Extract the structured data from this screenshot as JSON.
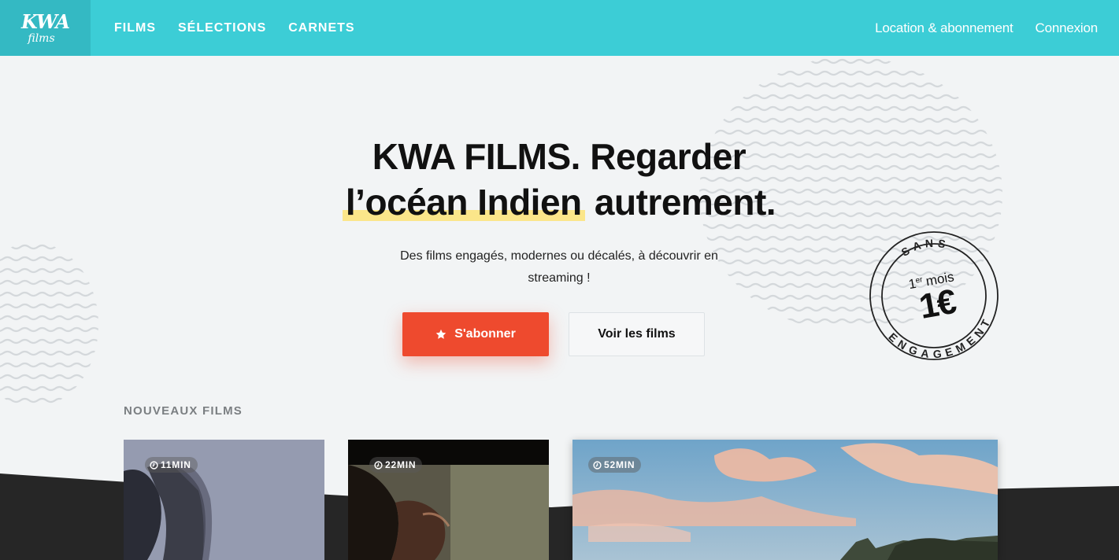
{
  "header": {
    "logo_line1": "KWA",
    "logo_line2": "films",
    "nav": [
      "FILMS",
      "SÉLECTIONS",
      "CARNETS"
    ],
    "right_links": [
      "Location & abonnement",
      "Connexion"
    ]
  },
  "hero": {
    "title_line1": "KWA FILMS. Regarder",
    "title_highlight": "l’océan Indien",
    "title_rest": " autrement.",
    "subtitle": "Des films engagés, modernes ou décalés, à découvrir en streaming !",
    "subscribe_label": "S'abonner",
    "films_label": "Voir les films"
  },
  "badge": {
    "top": "SANS",
    "bottom": "ENGAGEMENT",
    "ordinal": "1",
    "ordinal_sup": "er",
    "month": "mois",
    "price": "1€"
  },
  "section": {
    "title": "NOUVEAUX FILMS"
  },
  "films": [
    {
      "duration": "11MIN"
    },
    {
      "duration": "22MIN"
    },
    {
      "duration": "52MIN"
    }
  ],
  "colors": {
    "header": "#3ccdd6",
    "logo_bg": "#34b9c3",
    "accent": "#ee4a2e",
    "highlight": "#fbe68a",
    "background": "#f2f4f5",
    "dark": "#262626"
  },
  "icons": {
    "subscribe": "star-icon",
    "duration": "clock-icon"
  }
}
